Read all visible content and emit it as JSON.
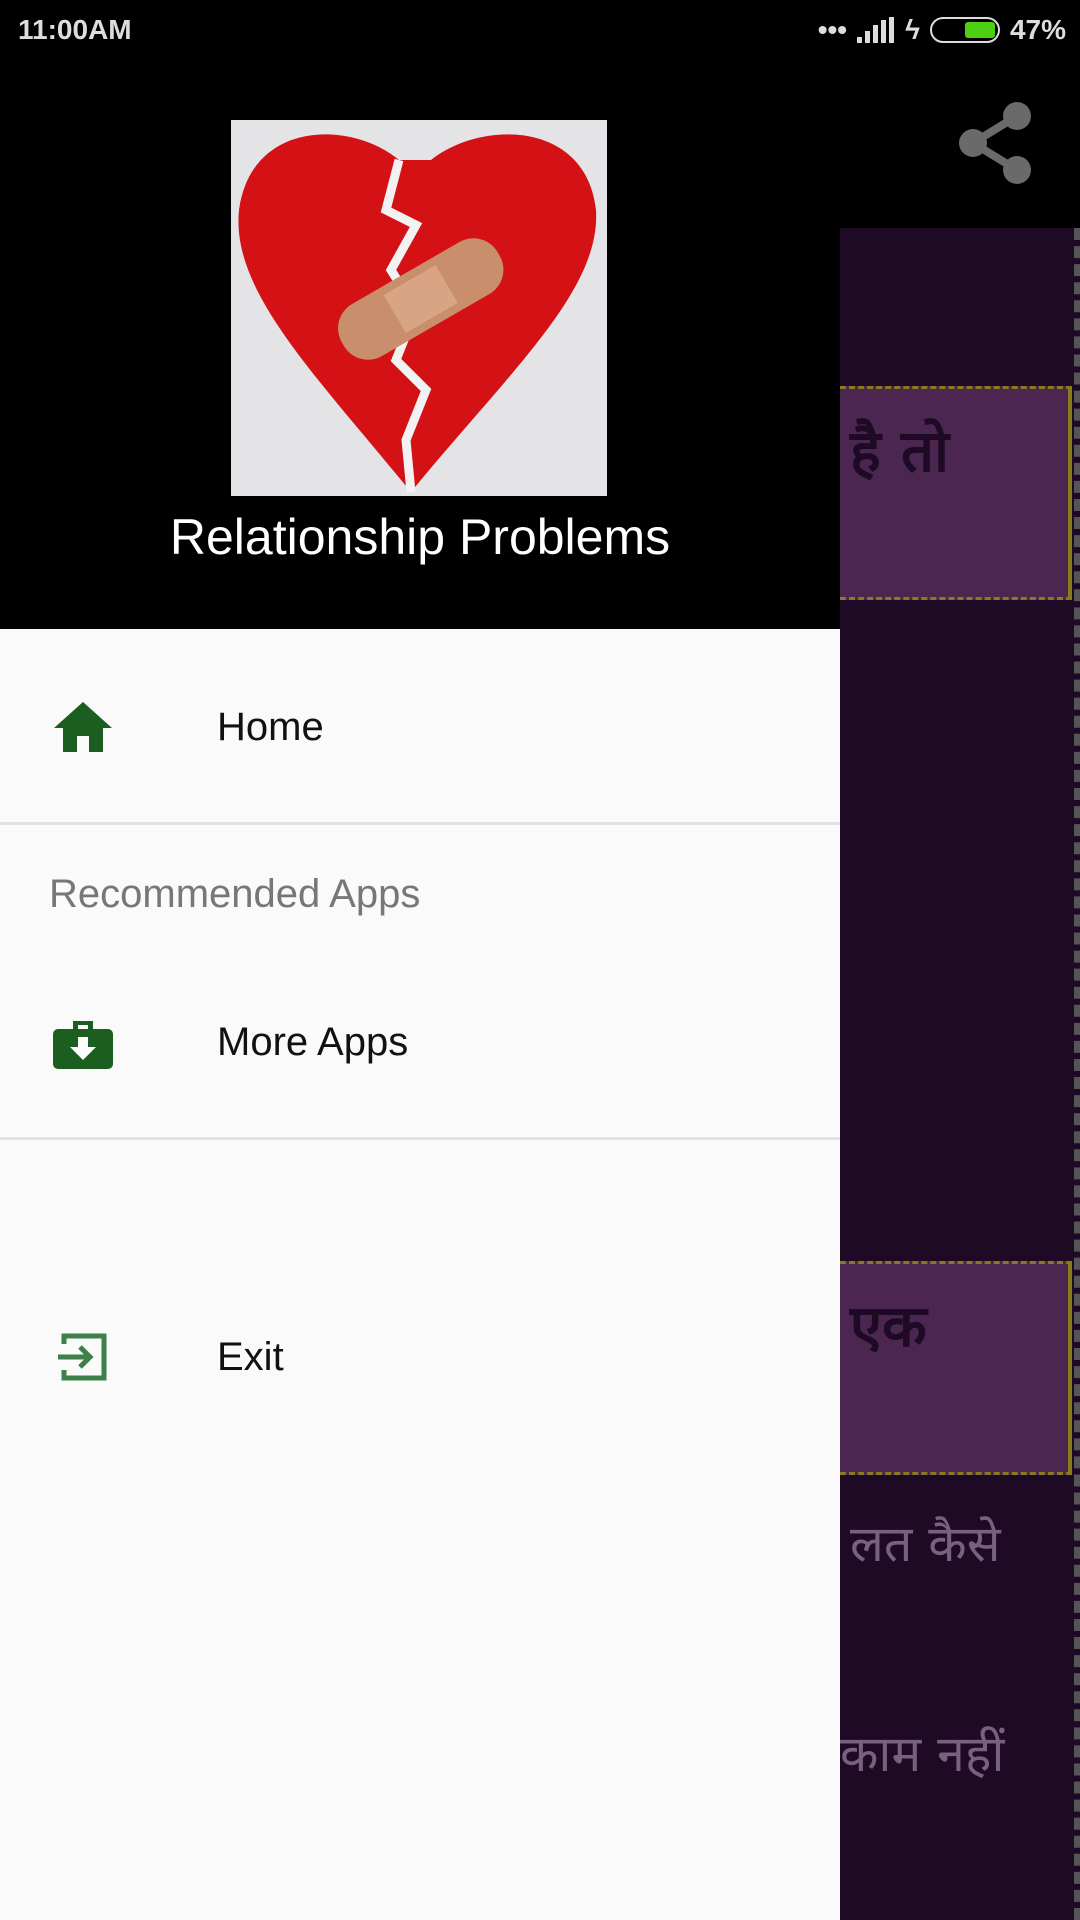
{
  "status_bar": {
    "time": "11:00AM",
    "battery": "47%",
    "battery_level": 0.47
  },
  "background": {
    "cards": [
      "है तो",
      "एक"
    ],
    "lines": [
      "लत कैसे",
      "काम नहीं"
    ]
  },
  "drawer": {
    "title": "Relationship Problems",
    "items": [
      {
        "label": "Home",
        "icon": "home-icon"
      },
      {
        "label": "More Apps",
        "icon": "briefcase-download-icon"
      },
      {
        "label": "Exit",
        "icon": "exit-icon"
      }
    ],
    "section_label": "Recommended Apps"
  },
  "colors": {
    "icon_green": "#1b5e20",
    "content_bg": "#1e0a25",
    "card_bg": "#4a2650"
  }
}
